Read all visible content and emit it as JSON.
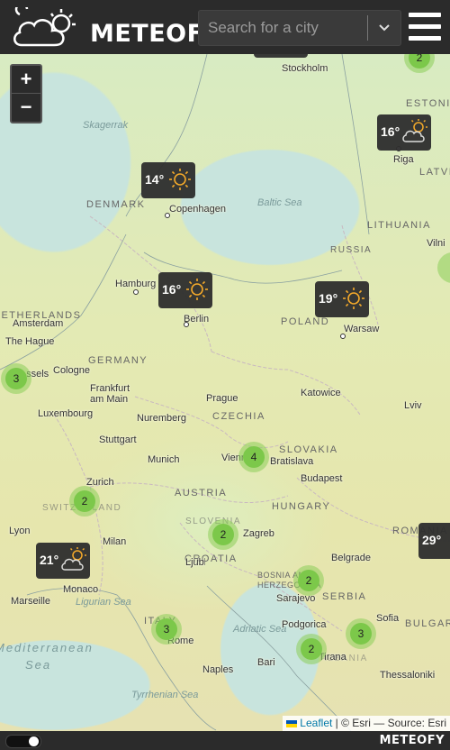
{
  "app": {
    "title": "METEOFY"
  },
  "search": {
    "placeholder": "Search for a city"
  },
  "zoom": {
    "in_label": "+",
    "out_label": "−"
  },
  "cities": [
    "Stockholm",
    "Riga",
    "Copenhagen",
    "Vilni",
    "Hamburg",
    "Amsterdam",
    "The Hague",
    "Berlin",
    "Warsaw",
    "Cologne",
    "Brussels",
    "Frankfurt am Main",
    "Prague",
    "Katowice",
    "Lviv",
    "Luxembourg",
    "Nuremberg",
    "Stuttgart",
    "Munich",
    "Vienna",
    "Bratislava",
    "Budapest",
    "Zurich",
    "Lyon",
    "Milan",
    "Ljubljana",
    "Zagreb",
    "Belgrade",
    "Monaco",
    "Marseille",
    "Sarajevo",
    "Podgorica",
    "Sofia",
    "Rome",
    "Bari",
    "Tirana",
    "Naples",
    "Thessaloniki"
  ],
  "countries": [
    "DENMARK",
    "LITHUANIA",
    "RUSSIA",
    "LATVIA",
    "ESTONIA",
    "POLAND",
    "GERMANY",
    "NETHERLANDS",
    "CZECHIA",
    "SLOVAKIA",
    "AUSTRIA",
    "HUNGARY",
    "SWITZERLAND",
    "SLOVENIA",
    "CROATIA",
    "BOSNIA AND HERZEGOVINA",
    "SERBIA",
    "ROMANIA",
    "BULGARIA",
    "ITALY",
    "ALBANIA"
  ],
  "seas": [
    "Skagerrak",
    "Baltic Sea",
    "Ligurian Sea",
    "Adriatic Sea",
    "Tyrrhenian Sea",
    "Sea"
  ],
  "sea_big": [
    "Mediterranean"
  ],
  "weather_markers": [
    {
      "temp": "14°",
      "icon": "sunny-icon"
    },
    {
      "temp": "16°",
      "icon": "sunny-icon"
    },
    {
      "temp": "19°",
      "icon": "sunny-icon"
    },
    {
      "temp": "16°",
      "icon": "partly-cloudy-icon"
    },
    {
      "temp": "21°",
      "icon": "partly-cloudy-icon"
    },
    {
      "temp": "29°",
      "icon": "sunny-icon"
    }
  ],
  "clusters": [
    "2",
    "3",
    "4",
    "2",
    "2",
    "2",
    "3",
    "2",
    "3"
  ],
  "attribution": {
    "leaflet": "Leaflet",
    "rest": "| © Esri — Source: Esri"
  },
  "footer": {
    "brand": "METEOFY"
  },
  "colors": {
    "header_bg": "#2b2b2b",
    "cluster": "#7cc84a",
    "sun": "#f5a623"
  }
}
